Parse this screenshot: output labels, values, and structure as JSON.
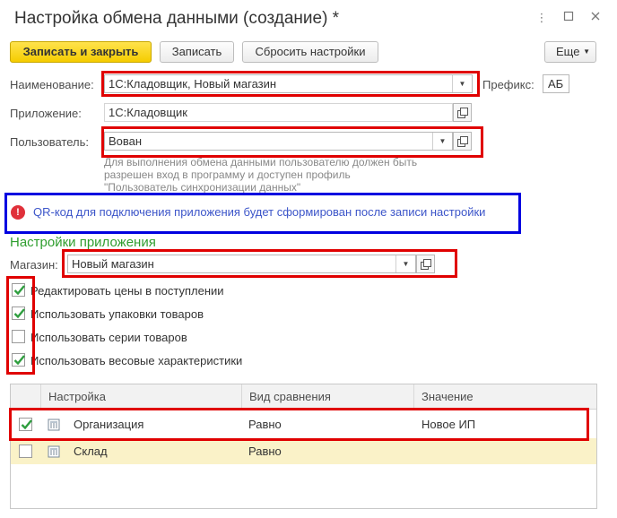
{
  "window": {
    "title": "Настройка обмена данными (создание) *"
  },
  "toolbar": {
    "save_close_label": "Записать и закрыть",
    "save_label": "Записать",
    "reset_label": "Сбросить настройки",
    "more_label": "Еще"
  },
  "form": {
    "name_label": "Наименование:",
    "name_value": "1С:Кладовщик, Новый магазин",
    "prefix_label": "Префикс:",
    "prefix_value": "АБ",
    "app_label": "Приложение:",
    "app_value": "1С:Кладовщик",
    "user_label": "Пользователь:",
    "user_value": "Вован",
    "hint_line1": "Для выполнения обмена данными пользователю должен быть",
    "hint_line2": "разрешен вход в программу и доступен профиль",
    "hint_line3": "\"Пользователь синхронизации данных\""
  },
  "warning": {
    "icon_text": "!",
    "text": "QR-код для подключения приложения будет сформирован после записи настройки"
  },
  "app_settings": {
    "section_title": "Настройки приложения",
    "store_label": "Магазин:",
    "store_value": "Новый магазин",
    "options": [
      {
        "label": "Редактировать цены в поступлении",
        "checked": true
      },
      {
        "label": "Использовать упаковки товаров",
        "checked": true
      },
      {
        "label": "Использовать серии товаров",
        "checked": false
      },
      {
        "label": "Использовать весовые характеристики",
        "checked": true
      }
    ]
  },
  "filter_table": {
    "headers": [
      "Настройка",
      "Вид сравнения",
      "Значение"
    ],
    "rows": [
      {
        "checked": true,
        "setting": "Организация",
        "comparison": "Равно",
        "value": "Новое ИП"
      },
      {
        "checked": false,
        "setting": "Склад",
        "comparison": "Равно",
        "value": ""
      }
    ]
  },
  "colors": {
    "primary_button": "#f5cc00",
    "highlight_red": "#e00000",
    "highlight_blue": "#0000e0",
    "section_green": "#2f9e2f",
    "check_green": "#2e9e3e",
    "selected_row": "#faf2c8"
  }
}
